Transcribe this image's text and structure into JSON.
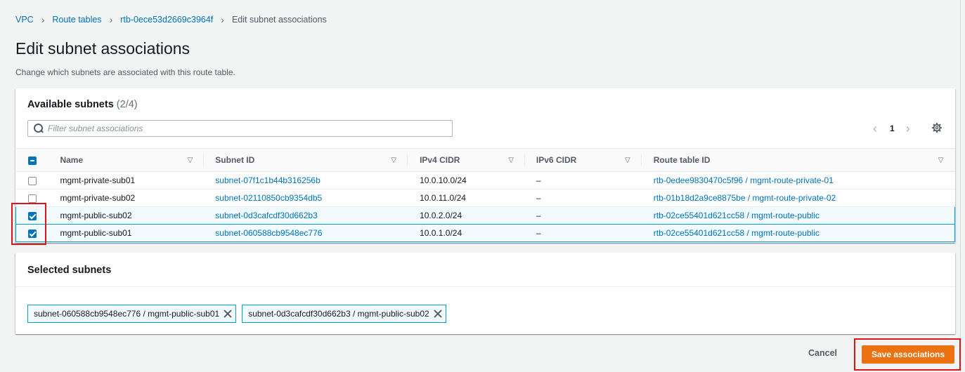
{
  "breadcrumb": {
    "items": [
      "VPC",
      "Route tables",
      "rtb-0ece53d2669c3964f"
    ],
    "current": "Edit subnet associations"
  },
  "page": {
    "title": "Edit subnet associations",
    "description": "Change which subnets are associated with this route table."
  },
  "available": {
    "heading": "Available subnets",
    "count": "(2/4)",
    "filter_placeholder": "Filter subnet associations",
    "page": "1",
    "columns": [
      "Name",
      "Subnet ID",
      "IPv4 CIDR",
      "IPv6 CIDR",
      "Route table ID"
    ],
    "rows": [
      {
        "checked": false,
        "name": "mgmt-private-sub01",
        "subnet_id": "subnet-07f1c1b44b316256b",
        "ipv4": "10.0.10.0/24",
        "ipv6": "–",
        "route_table": "rtb-0edee9830470c5f96 / mgmt-route-private-01"
      },
      {
        "checked": false,
        "name": "mgmt-private-sub02",
        "subnet_id": "subnet-02110850cb9354db5",
        "ipv4": "10.0.11.0/24",
        "ipv6": "–",
        "route_table": "rtb-01b18d2a9ce8875be / mgmt-route-private-02"
      },
      {
        "checked": true,
        "name": "mgmt-public-sub02",
        "subnet_id": "subnet-0d3cafcdf30d662b3",
        "ipv4": "10.0.2.0/24",
        "ipv6": "–",
        "route_table": "rtb-02ce55401d621cc58 / mgmt-route-public"
      },
      {
        "checked": true,
        "name": "mgmt-public-sub01",
        "subnet_id": "subnet-060588cb9548ec776",
        "ipv4": "10.0.1.0/24",
        "ipv6": "–",
        "route_table": "rtb-02ce55401d621cc58 / mgmt-route-public"
      }
    ]
  },
  "selected": {
    "heading": "Selected subnets",
    "tokens": [
      "subnet-060588cb9548ec776 / mgmt-public-sub01",
      "subnet-0d3cafcdf30d662b3 / mgmt-public-sub02"
    ]
  },
  "actions": {
    "cancel_label": "Cancel",
    "save_label": "Save associations"
  },
  "colors": {
    "link": "#0073bb",
    "primary_button": "#ec7211",
    "selection_border": "#00a1c9",
    "highlight": "#e0131a"
  }
}
